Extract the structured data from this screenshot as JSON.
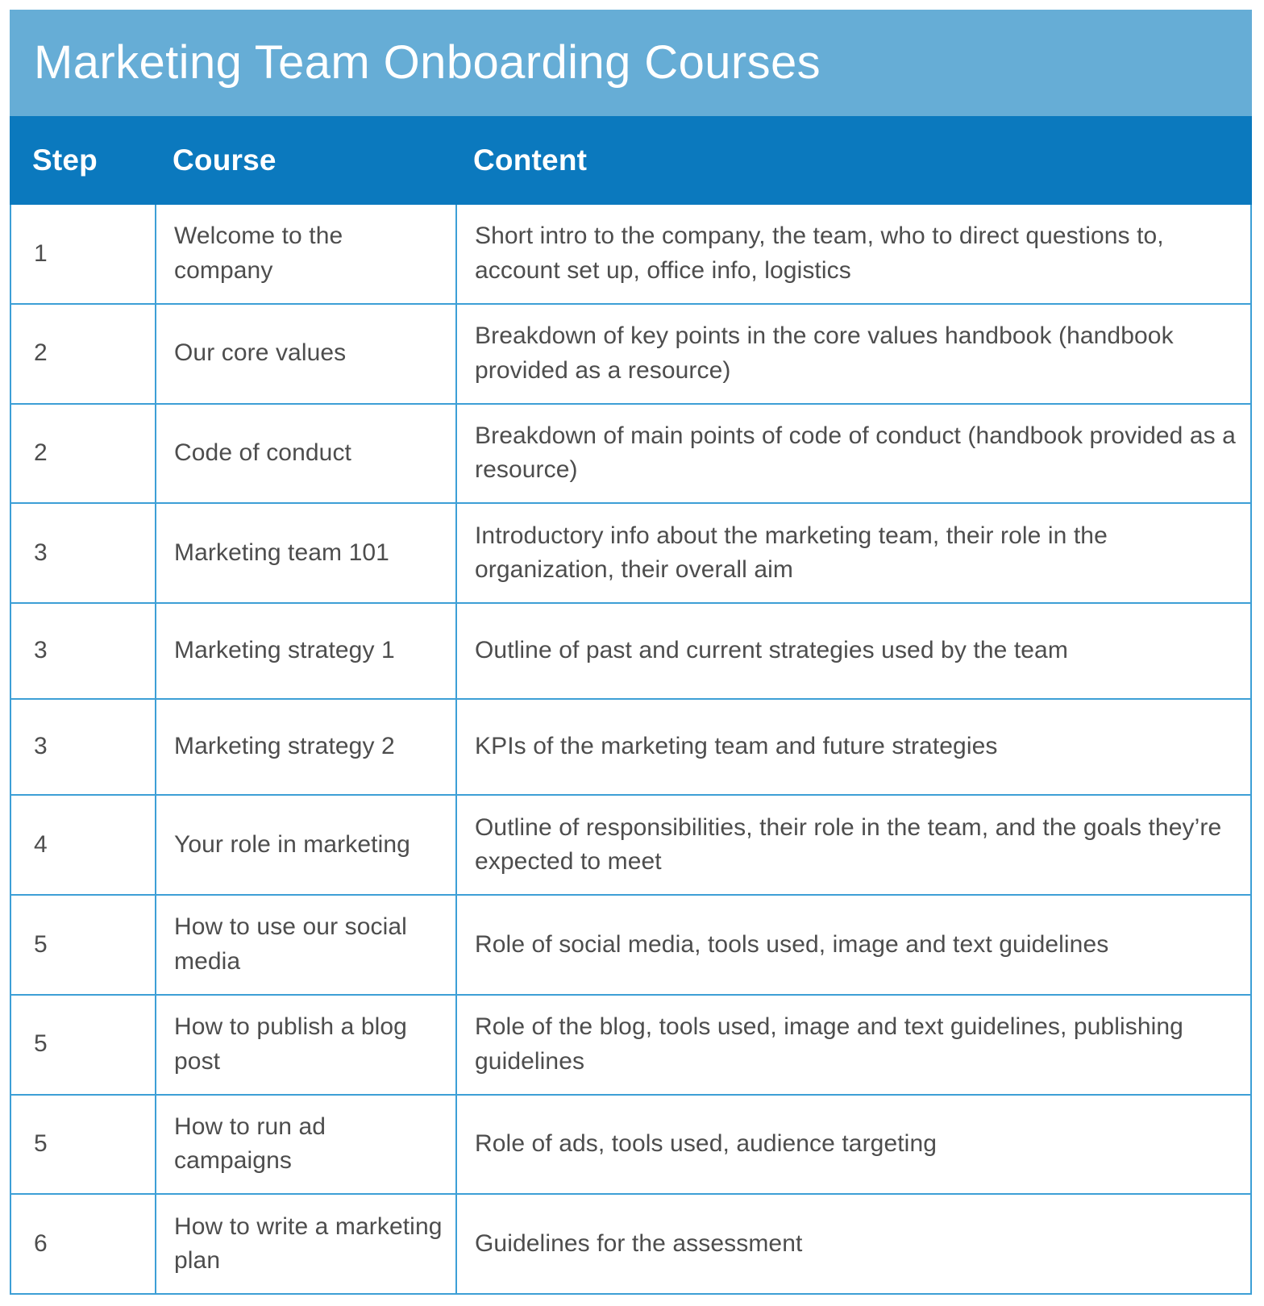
{
  "title": "Marketing Team Onboarding Courses",
  "colors": {
    "title_band": "#66add6",
    "header_band": "#0b79be",
    "grid_line": "#3d9fd6",
    "body_text": "#4d4d4d",
    "header_text": "#ffffff"
  },
  "columns": [
    {
      "key": "step",
      "label": "Step"
    },
    {
      "key": "course",
      "label": "Course"
    },
    {
      "key": "content",
      "label": "Content"
    }
  ],
  "rows": [
    {
      "step": "1",
      "course": "Welcome to the company",
      "content": "Short intro to the company, the team, who to direct questions to, account set up, office info, logistics"
    },
    {
      "step": "2",
      "course": "Our core values",
      "content": "Breakdown of key points in the core values handbook (handbook provided as a resource)"
    },
    {
      "step": "2",
      "course": "Code of conduct",
      "content": "Breakdown of main points of code of conduct (handbook provided as a resource)"
    },
    {
      "step": "3",
      "course": "Marketing team 101",
      "content": "Introductory info about the marketing team, their role in the organization, their overall aim"
    },
    {
      "step": "3",
      "course": "Marketing strategy 1",
      "content": "Outline of past and current strategies used by the team"
    },
    {
      "step": "3",
      "course": "Marketing strategy 2",
      "content": "KPIs of the marketing team and future strategies"
    },
    {
      "step": "4",
      "course": "Your role in marketing",
      "content": "Outline of responsibilities, their role in the team, and the goals they’re expected to meet"
    },
    {
      "step": "5",
      "course": "How to use our social media",
      "content": "Role of social media, tools used, image and text guidelines"
    },
    {
      "step": "5",
      "course": "How to publish a blog post",
      "content": "Role of the blog, tools used, image and text guidelines, publishing guidelines"
    },
    {
      "step": "5",
      "course": "How to run ad campaigns",
      "content": "Role of ads, tools used, audience targeting"
    },
    {
      "step": "6",
      "course": "How to write a marketing plan",
      "content": "Guidelines for the assessment"
    }
  ]
}
